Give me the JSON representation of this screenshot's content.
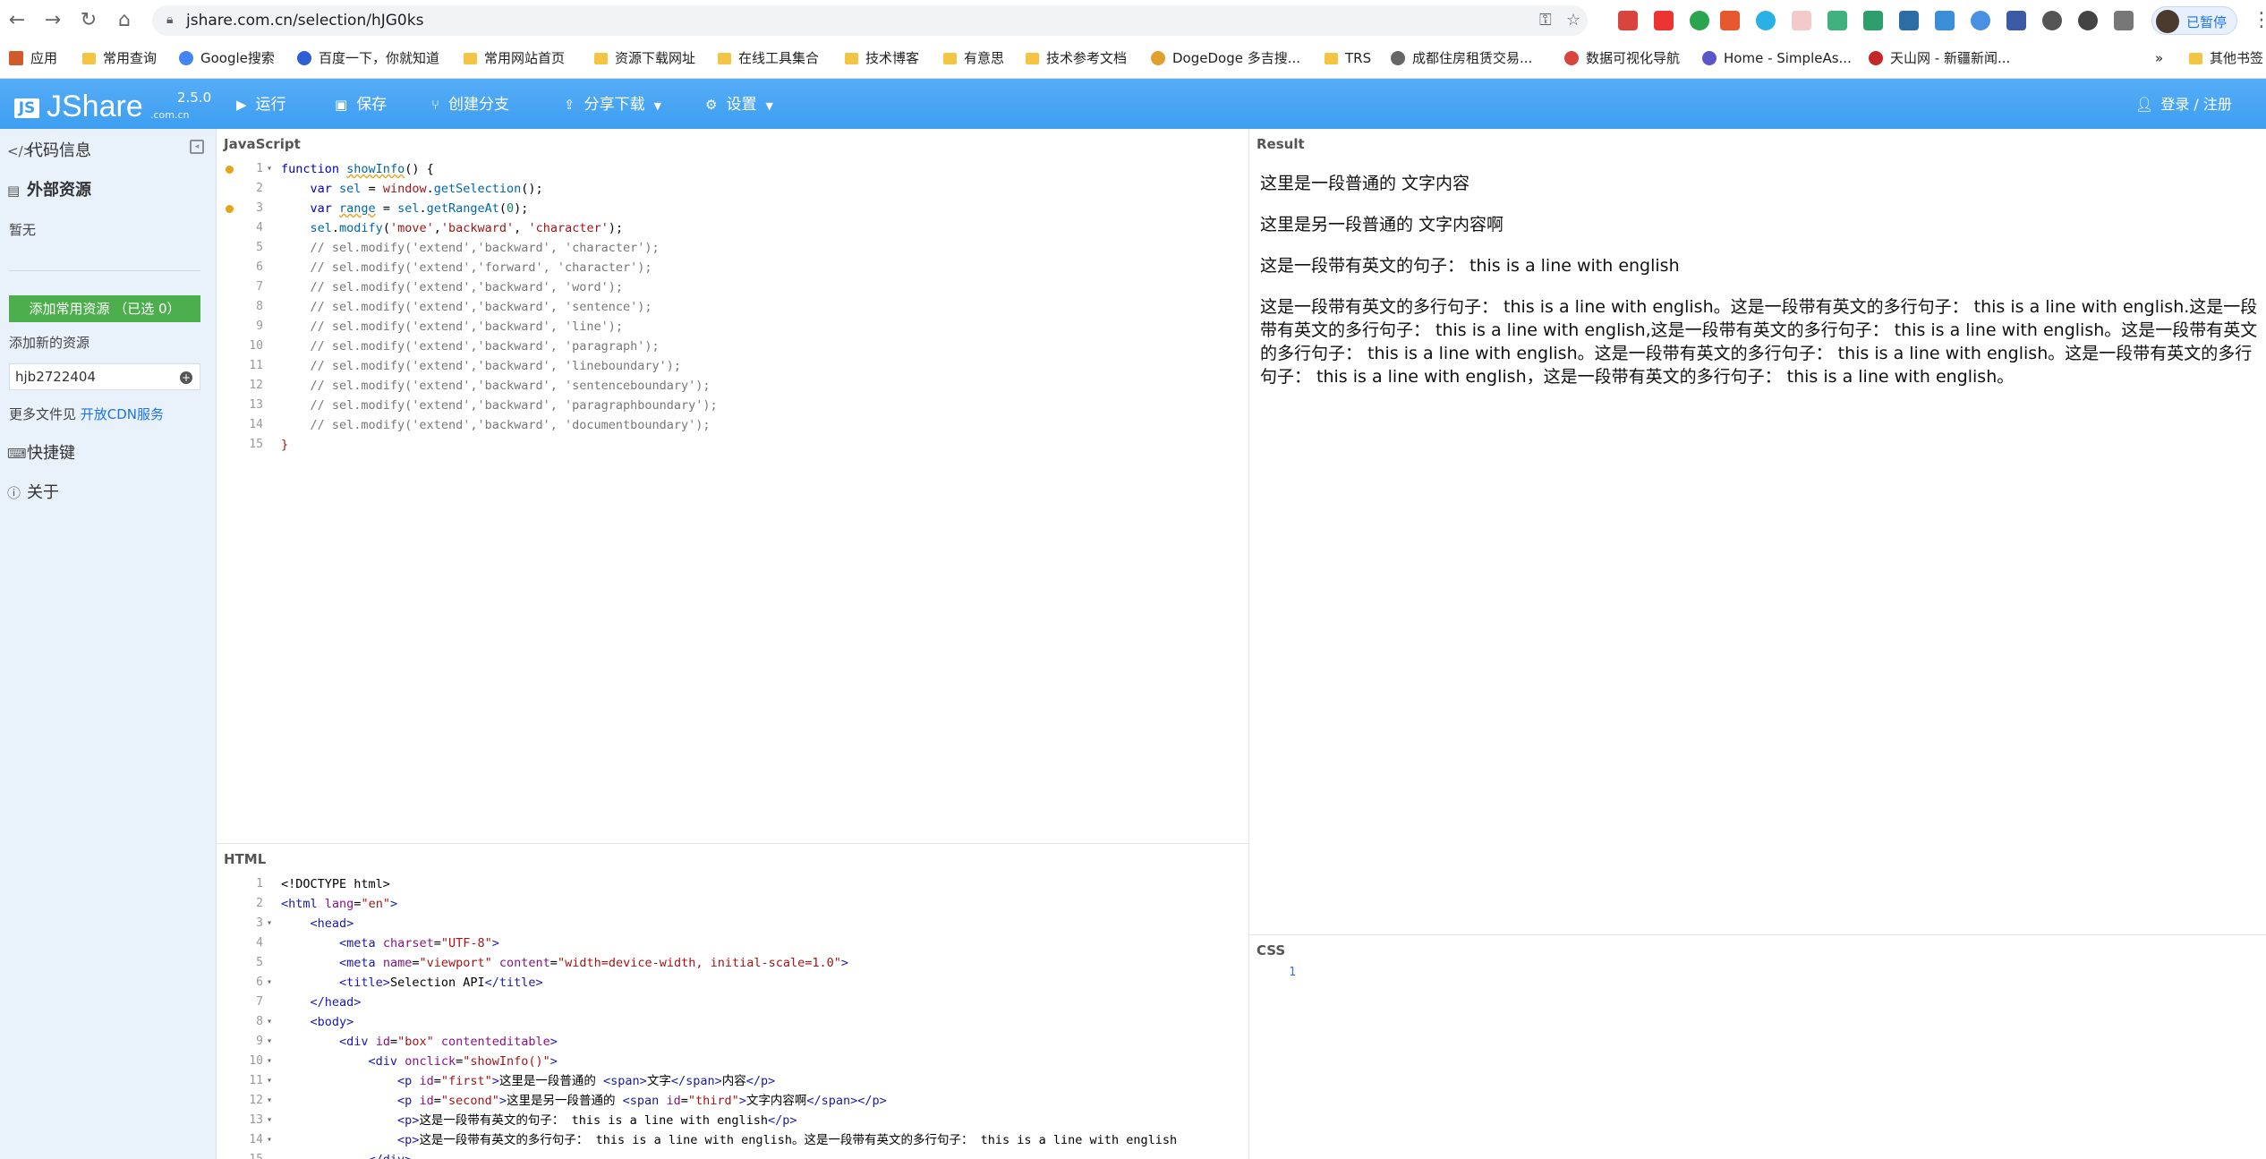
{
  "browser": {
    "url": "jshare.com.cn/selection/hJG0ks",
    "profile_label": "已暂停"
  },
  "bookmarks": [
    "应用",
    "常用查询",
    "Google搜索",
    "百度一下，你就知道",
    "常用网站首页",
    "资源下载网址",
    "在线工具集合",
    "技术博客",
    "有意思",
    "技术参考文档",
    "DogeDoge 多吉搜...",
    "TRS",
    "成都住房租赁交易...",
    "数据可视化导航",
    "Home - SimpleAs...",
    "天山网 - 新疆新闻...",
    "»",
    "其他书签"
  ],
  "app": {
    "logo_name": "JShare",
    "logo_domain": ".com.cn",
    "version": "2.5.0",
    "toolbar": {
      "run": "运行",
      "save": "保存",
      "fork": "创建分支",
      "share": "分享下载",
      "settings": "设置"
    },
    "login": "登录 / 注册"
  },
  "sidebar": {
    "code_info": "代码信息",
    "external": "外部资源",
    "none": "暂无",
    "add_common": "添加常用资源 （已选 0）",
    "add_new": "添加新的资源",
    "resource_value": "hjb2722404",
    "more_files": "更多文件见 ",
    "cdn_link": "开放CDN服务",
    "shortcuts": "快捷键",
    "about": "关于"
  },
  "panes": {
    "js_label": "JavaScript",
    "html_label": "HTML",
    "result_label": "Result",
    "css_label": "CSS"
  },
  "js_code": [
    {
      "n": "1",
      "fold": true,
      "warn": true,
      "html": "<span class='kw'>function</span> <span class='fn ul'>showInfo</span>() {"
    },
    {
      "n": "2",
      "html": "    <span class='kw'>var</span> <span class='fn'>sel</span> = <span class='str'>window</span>.<span class='fn'>getSelection</span>();"
    },
    {
      "n": "3",
      "warn": true,
      "html": "    <span class='kw'>var</span> <span class='fn ul'>range</span> = <span class='fn'>sel</span>.<span class='fn'>getRangeAt</span>(<span class='num'>0</span>);"
    },
    {
      "n": "4",
      "html": "    <span class='fn'>sel</span>.<span class='fn'>modify</span>(<span class='str'>'move'</span>,<span class='str'>'backward'</span>, <span class='str'>'character'</span>);"
    },
    {
      "n": "5",
      "html": "    <span class='cm'>// sel.modify('extend','backward', 'character');</span>"
    },
    {
      "n": "6",
      "html": "    <span class='cm'>// sel.modify('extend','forward', 'character');</span>"
    },
    {
      "n": "7",
      "html": "    <span class='cm'>// sel.modify('extend','backward', 'word');</span>"
    },
    {
      "n": "8",
      "html": "    <span class='cm'>// sel.modify('extend','backward', 'sentence');</span>"
    },
    {
      "n": "9",
      "html": "    <span class='cm'>// sel.modify('extend','backward', 'line');</span>"
    },
    {
      "n": "10",
      "html": "    <span class='cm'>// sel.modify('extend','backward', 'paragraph');</span>"
    },
    {
      "n": "11",
      "html": "    <span class='cm'>// sel.modify('extend','backward', 'lineboundary');</span>"
    },
    {
      "n": "12",
      "html": "    <span class='cm'>// sel.modify('extend','backward', 'sentenceboundary');</span>"
    },
    {
      "n": "13",
      "html": "    <span class='cm'>// sel.modify('extend','backward', 'paragraphboundary');</span>"
    },
    {
      "n": "14",
      "html": "    <span class='cm'>// sel.modify('extend','backward', 'documentboundary');</span>"
    },
    {
      "n": "15",
      "html": "<span class='str'>}</span>"
    }
  ],
  "html_code": [
    {
      "n": "1",
      "html": "&lt;!DOCTYPE html&gt;"
    },
    {
      "n": "2",
      "html": "<span class='tag'>&lt;html</span> <span class='attr'>lang</span>=<span class='str'>\"en\"</span><span class='tag'>&gt;</span>"
    },
    {
      "n": "3",
      "fold": true,
      "html": "    <span class='tag'>&lt;head&gt;</span>"
    },
    {
      "n": "4",
      "html": "        <span class='tag'>&lt;meta</span> <span class='attr'>charset</span>=<span class='str'>\"UTF-8\"</span><span class='tag'>&gt;</span>"
    },
    {
      "n": "5",
      "html": "        <span class='tag'>&lt;meta</span> <span class='attr'>name</span>=<span class='str'>\"viewport\"</span> <span class='attr'>content</span>=<span class='str'>\"width=device-width, initial-scale=1.0\"</span><span class='tag'>&gt;</span>"
    },
    {
      "n": "6",
      "fold": true,
      "html": "        <span class='tag'>&lt;title&gt;</span>Selection API<span class='tag'>&lt;/title&gt;</span>"
    },
    {
      "n": "7",
      "html": "    <span class='tag'>&lt;/head&gt;</span>"
    },
    {
      "n": "8",
      "fold": true,
      "html": "    <span class='tag'>&lt;body&gt;</span>"
    },
    {
      "n": "9",
      "fold": true,
      "html": "        <span class='tag'>&lt;div</span> <span class='attr'>id</span>=<span class='str'>\"box\"</span> <span class='attr'>contenteditable</span><span class='tag'>&gt;</span>"
    },
    {
      "n": "10",
      "fold": true,
      "html": "            <span class='tag'>&lt;div</span> <span class='attr'>onclick</span>=<span class='str'>\"showInfo()\"</span><span class='tag'>&gt;</span>"
    },
    {
      "n": "11",
      "fold": true,
      "html": "                <span class='tag'>&lt;p</span> <span class='attr'>id</span>=<span class='str'>\"first\"</span><span class='tag'>&gt;</span>这里是一段普通的 <span class='tag'>&lt;span&gt;</span>文字<span class='tag'>&lt;/span&gt;</span>内容<span class='tag'>&lt;/p&gt;</span>"
    },
    {
      "n": "12",
      "fold": true,
      "html": "                <span class='tag'>&lt;p</span> <span class='attr'>id</span>=<span class='str'>\"second\"</span><span class='tag'>&gt;</span>这里是另一段普通的 <span class='tag'>&lt;span</span> <span class='attr'>id</span>=<span class='str'>\"third\"</span><span class='tag'>&gt;</span>文字内容啊<span class='tag'>&lt;/span&gt;&lt;/p&gt;</span>"
    },
    {
      "n": "13",
      "fold": true,
      "html": "                <span class='tag'>&lt;p&gt;</span>这是一段带有英文的句子： this is a line with english<span class='tag'>&lt;/p&gt;</span>"
    },
    {
      "n": "14",
      "fold": true,
      "html": "                <span class='tag'>&lt;p&gt;</span>这是一段带有英文的多行句子： this is a line with english。这是一段带有英文的多行句子： this is a line with english"
    },
    {
      "n": "15",
      "html": "            <span class='tag'>&lt;/div&gt;</span>"
    }
  ],
  "result": [
    "这里是一段普通的 文字内容",
    "这里是另一段普通的 文字内容啊",
    "这是一段带有英文的句子： this is a line with english",
    "这是一段带有英文的多行句子： this is a line with english。这是一段带有英文的多行句子： this is a line with english.这是一段带有英文的多行句子： this is a line with english,这是一段带有英文的多行句子： this is a line with english。这是一段带有英文的多行句子： this is a line with english。这是一段带有英文的多行句子： this is a line with english。这是一段带有英文的多行句子： this is a line with english，这是一段带有英文的多行句子： this is a line with english。"
  ],
  "css_code": [
    {
      "n": "1"
    }
  ],
  "colors": {
    "accent": "#3d9ef0",
    "add_button": "#4cae4c",
    "sidebar_bg": "#e9f1fb"
  }
}
